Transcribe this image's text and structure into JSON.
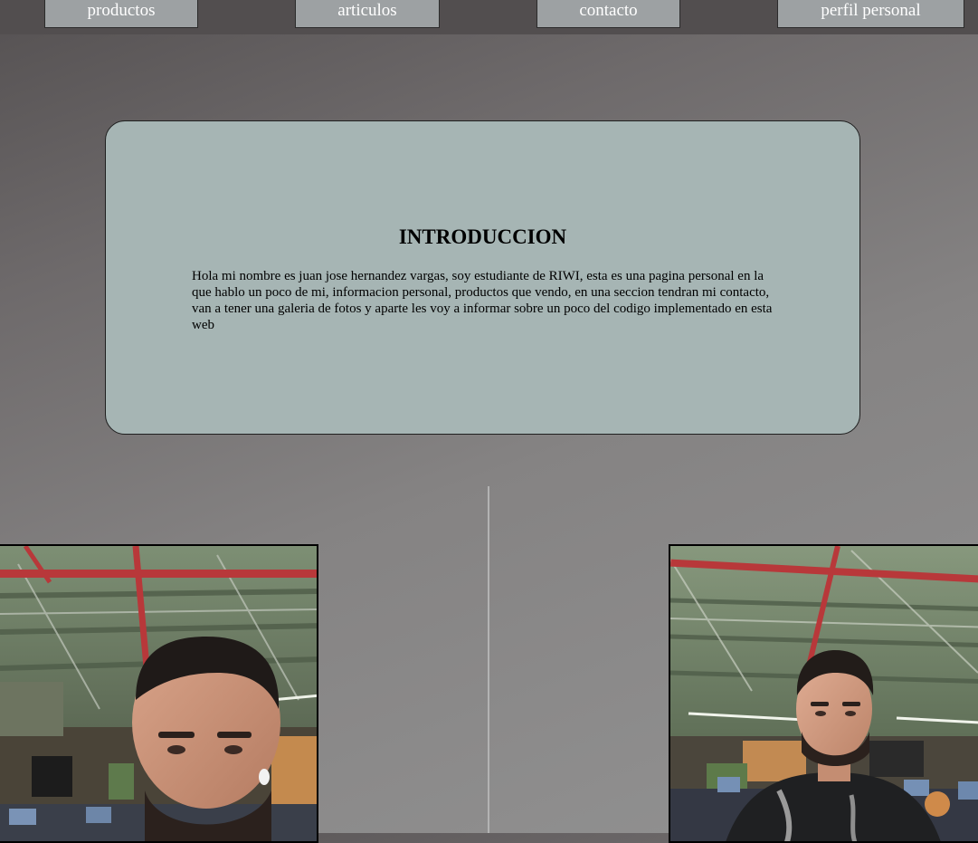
{
  "nav": {
    "items": [
      {
        "label": "productos"
      },
      {
        "label": "articulos"
      },
      {
        "label": "contacto"
      },
      {
        "label": "perfil personal"
      }
    ]
  },
  "intro": {
    "title": "INTRODUCCION",
    "text": "Hola mi nombre es juan jose hernandez vargas, soy estudiante de RIWI, esta es una pagina personal en la que hablo un poco de mi, informacion personal, productos que vendo, en una seccion tendran mi contacto, van a tener una galeria de fotos y aparte les voy a informar sobre un poco del codigo implementado en esta web"
  },
  "gallery": {
    "photos": [
      {
        "subject": "selfie-office-photo"
      },
      {
        "subject": "portrait-office-photo"
      }
    ]
  },
  "colors": {
    "topbar": "#524e4f",
    "nav_button": "#9da1a3",
    "card": "#a6b5b4",
    "divider": "#b3b3b3"
  }
}
